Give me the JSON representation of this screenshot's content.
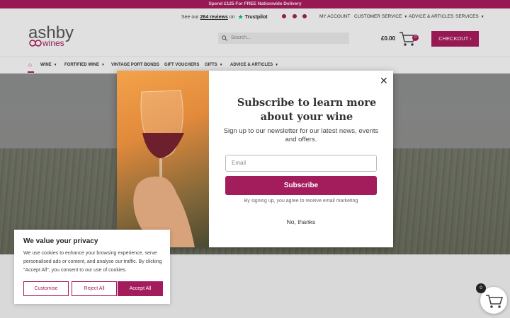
{
  "promo": {
    "text": "Spend £125 For FREE Nationwide Delivery"
  },
  "header": {
    "reviews_prefix": "See our",
    "reviews_count": "264 reviews",
    "reviews_on": "on",
    "trustpilot": "Trustpilot",
    "util_nav": [
      "MY ACCOUNT",
      "CUSTOMER SERVICE",
      "ADVICE & ARTICLES",
      "SERVICES"
    ],
    "logo_top": "ashby",
    "logo_bottom": "wines",
    "search_placeholder": "Search...",
    "cart_price": "£0.00",
    "cart_count": "0",
    "checkout_label": "CHECKOUT"
  },
  "nav": {
    "items": [
      "WINE",
      "FORTIFIED WINE",
      "VINTAGE PORT BONDS",
      "GIFT VOUCHERS",
      "GIFTS",
      "ADVICE & ARTICLES"
    ]
  },
  "modal": {
    "title": "Subscribe to learn more about your wine",
    "subtitle": "Sign up to our newsletter for our latest news, events and offers.",
    "email_placeholder": "Email",
    "subscribe_label": "Subscribe",
    "note": "By signing up, you agree to receive email marketing",
    "decline_label": "No, thanks"
  },
  "cookie": {
    "title": "We value your privacy",
    "text": "We use cookies to enhance your browsing experience, serve personalised ads or content, and analyse our traffic. By clicking \"Accept All\", you consent to our use of cookies.",
    "customise": "Customise",
    "reject": "Reject All",
    "accept": "Accept All"
  },
  "floating_cart": {
    "count": "0"
  },
  "colors": {
    "brand": "#a31c5c",
    "trustpilot": "#00b67a"
  }
}
